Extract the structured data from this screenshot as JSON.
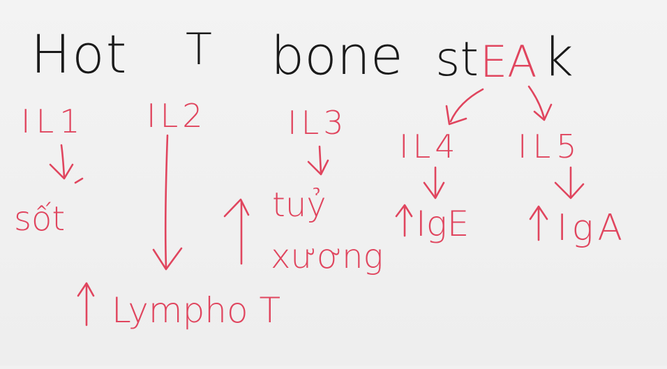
{
  "title": {
    "word_hot": "Hot",
    "word_t": "T",
    "word_bone": "bone",
    "word_st": "st",
    "word_ea": "EA",
    "word_k": "k"
  },
  "nodes": {
    "il1": "IL1",
    "il2": "IL2",
    "il3": "IL3",
    "il4": "IL4",
    "il5": "IL5"
  },
  "effects": {
    "il1": "sốt",
    "il2": "Lympho T",
    "il3_line1": "tuỷ",
    "il3_line2": "xương",
    "il4": "IgE",
    "il5": "IgA"
  },
  "colors": {
    "ink_black": "#1a1a1a",
    "ink_red": "#e0455e",
    "background": "#f1f1f1"
  }
}
